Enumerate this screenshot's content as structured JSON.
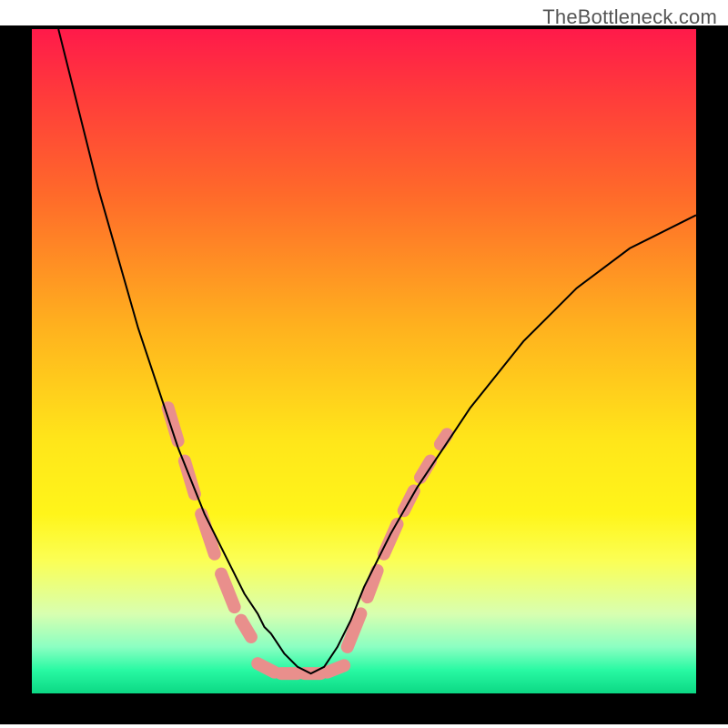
{
  "watermark": "TheBottleneck.com",
  "chart_data": {
    "type": "line",
    "title": "",
    "xlabel": "",
    "ylabel": "",
    "xlim": [
      0,
      100
    ],
    "ylim": [
      0,
      100
    ],
    "background_gradient_stops": [
      {
        "offset": 0.0,
        "color": "#ff1a4a"
      },
      {
        "offset": 0.1,
        "color": "#ff3b3b"
      },
      {
        "offset": 0.25,
        "color": "#ff6a2a"
      },
      {
        "offset": 0.45,
        "color": "#ffb21e"
      },
      {
        "offset": 0.62,
        "color": "#ffe61a"
      },
      {
        "offset": 0.73,
        "color": "#fff51a"
      },
      {
        "offset": 0.8,
        "color": "#fbff55"
      },
      {
        "offset": 0.88,
        "color": "#d8ffb0"
      },
      {
        "offset": 0.93,
        "color": "#8bffc2"
      },
      {
        "offset": 0.965,
        "color": "#28f9a3"
      },
      {
        "offset": 1.0,
        "color": "#0cd884"
      }
    ],
    "series": [
      {
        "name": "curve",
        "stroke": "#000000",
        "x": [
          4,
          6,
          8,
          10,
          12,
          14,
          16,
          18,
          20,
          22,
          24,
          26,
          28,
          30,
          32,
          34,
          35,
          36,
          38,
          40,
          42,
          44,
          46,
          48,
          50,
          54,
          58,
          62,
          66,
          70,
          74,
          78,
          82,
          86,
          90,
          94,
          98,
          100
        ],
        "y": [
          100,
          92,
          84,
          76,
          69,
          62,
          55,
          49,
          43,
          37,
          32,
          27,
          23,
          19,
          15,
          12,
          10,
          9,
          6,
          4,
          3,
          4,
          7,
          11,
          16,
          24,
          31,
          37,
          43,
          48,
          53,
          57,
          61,
          64,
          67,
          69,
          71,
          72
        ]
      }
    ],
    "salmon_segments": {
      "color": "#e98f8c",
      "width": 14,
      "left": [
        {
          "x1": 20.5,
          "y1": 43,
          "x2": 22.0,
          "y2": 38
        },
        {
          "x1": 23.0,
          "y1": 35,
          "x2": 24.5,
          "y2": 30
        },
        {
          "x1": 25.5,
          "y1": 27,
          "x2": 27.5,
          "y2": 21
        },
        {
          "x1": 28.5,
          "y1": 18,
          "x2": 30.5,
          "y2": 13
        },
        {
          "x1": 31.5,
          "y1": 11,
          "x2": 33.0,
          "y2": 8.5
        }
      ],
      "bottom": [
        {
          "x1": 34.0,
          "y1": 4.5,
          "x2": 36.5,
          "y2": 3.2
        },
        {
          "x1": 37.5,
          "y1": 3.0,
          "x2": 40.0,
          "y2": 3.0
        },
        {
          "x1": 41.0,
          "y1": 3.0,
          "x2": 43.5,
          "y2": 3.0
        },
        {
          "x1": 44.5,
          "y1": 3.2,
          "x2": 47.0,
          "y2": 4.2
        }
      ],
      "right": [
        {
          "x1": 47.5,
          "y1": 7.0,
          "x2": 49.5,
          "y2": 12.0
        },
        {
          "x1": 50.5,
          "y1": 14.5,
          "x2": 52.0,
          "y2": 18.5
        },
        {
          "x1": 53.0,
          "y1": 21.0,
          "x2": 55.0,
          "y2": 25.5
        },
        {
          "x1": 56.0,
          "y1": 27.5,
          "x2": 57.5,
          "y2": 30.5
        },
        {
          "x1": 58.5,
          "y1": 32.5,
          "x2": 60.0,
          "y2": 35.0
        },
        {
          "x1": 61.5,
          "y1": 37.5,
          "x2": 62.5,
          "y2": 39.0
        }
      ]
    }
  }
}
